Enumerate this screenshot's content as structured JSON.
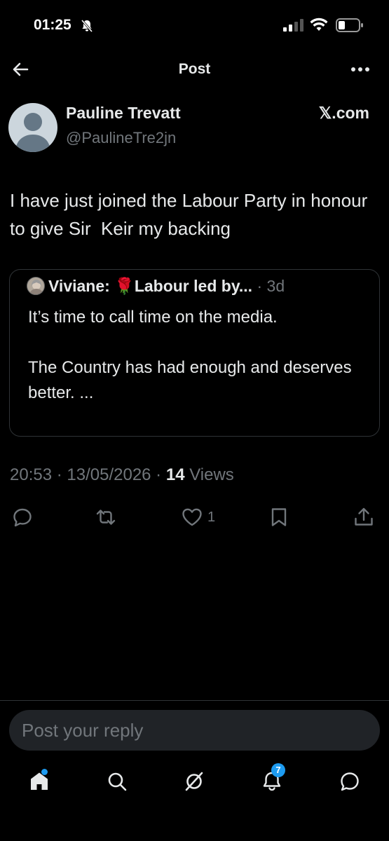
{
  "status_bar": {
    "time": "01:25",
    "icons": [
      "mute-bell-icon",
      "signal-icon",
      "wifi-icon",
      "battery-icon"
    ]
  },
  "header": {
    "title": "Post",
    "back_icon": "arrow-left-icon",
    "more_icon": "more-horizontal-icon"
  },
  "post": {
    "author_name": "Pauline Trevatt",
    "author_handle": "@PaulineTre2jn",
    "source_label": "𝕏.com",
    "text": "I have just joined the Labour Party in honour to give Sir  Keir my backing",
    "quote": {
      "author": "Viviane: 🌹Labour led by...",
      "separator": " · ",
      "time": "3d",
      "text": "It’s time to call time on the media.\n\nThe Country has had enough and deserves better. ..."
    },
    "time": "20:53",
    "sep1": " · ",
    "date": "13/05/2026",
    "sep2": " · ",
    "views_count": "14",
    "views_label": " Views",
    "like_count": "1"
  },
  "reply": {
    "placeholder": "Post your reply"
  },
  "nav": {
    "notification_badge": "7"
  },
  "colors": {
    "background": "#000000",
    "text": "#e7e9ea",
    "secondary": "#71767b",
    "accent": "#1d9bf0",
    "border": "#2f3336"
  }
}
